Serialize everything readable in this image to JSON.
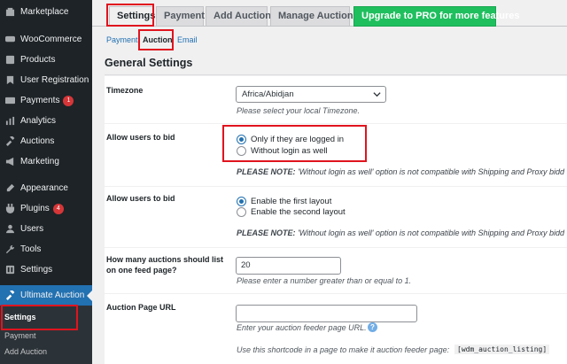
{
  "sidebar": {
    "items": [
      {
        "label": "Marketplace",
        "icon": "marketplace-icon"
      },
      {
        "label": "WooCommerce",
        "icon": "woocommerce-icon"
      },
      {
        "label": "Products",
        "icon": "products-icon"
      },
      {
        "label": "User Registration",
        "icon": "user-registration-icon"
      },
      {
        "label": "Payments",
        "icon": "payments-icon",
        "badge": "1"
      },
      {
        "label": "Analytics",
        "icon": "analytics-icon"
      },
      {
        "label": "Auctions",
        "icon": "auctions-icon"
      },
      {
        "label": "Marketing",
        "icon": "marketing-icon"
      },
      {
        "label": "Appearance",
        "icon": "appearance-icon"
      },
      {
        "label": "Plugins",
        "icon": "plugins-icon",
        "badge": "4"
      },
      {
        "label": "Users",
        "icon": "users-icon"
      },
      {
        "label": "Tools",
        "icon": "tools-icon"
      },
      {
        "label": "Settings",
        "icon": "settings-icon"
      },
      {
        "label": "Ultimate Auction",
        "icon": "ultimate-auction-icon"
      }
    ],
    "submenu": [
      {
        "label": "Settings"
      },
      {
        "label": "Payment"
      },
      {
        "label": "Add Auction"
      }
    ]
  },
  "tabs": [
    {
      "label": "Settings"
    },
    {
      "label": "Payment"
    },
    {
      "label": "Add Auction"
    },
    {
      "label": "Manage Auctions"
    },
    {
      "label": "Upgrade to PRO for more features"
    }
  ],
  "subnav": [
    {
      "label": "Payment"
    },
    {
      "label": "Auction"
    },
    {
      "label": "Email"
    }
  ],
  "general_settings_title": "General Settings",
  "rows": {
    "timezone": {
      "label": "Timezone",
      "selected": "Africa/Abidjan",
      "description": "Please select your local Timezone."
    },
    "allow_bid_1": {
      "label": "Allow users to bid",
      "options": [
        "Only if they are logged in",
        "Without login as well"
      ],
      "note_bold": "PLEASE NOTE:",
      "note_text": " 'Without login as well' option is not compatible with Shipping and Proxy bidd"
    },
    "allow_bid_2": {
      "label": "Allow users to bid",
      "options": [
        "Enable the first layout",
        "Enable the second layout"
      ],
      "note_bold": "PLEASE NOTE:",
      "note_text": " 'Without login as well' option is not compatible with Shipping and Proxy bidd"
    },
    "feed_count": {
      "label_line1": "How many auctions should list",
      "label_line2": "on one feed page?",
      "value": "20",
      "description": "Please enter a number greater than or equal to 1."
    },
    "page_url": {
      "label": "Auction Page URL",
      "value": "",
      "description": "Enter your auction feeder page URL.",
      "help": "?",
      "shortcode_text": "Use this shortcode in a page to make it auction feeder page:",
      "shortcode": "[wdm_auction_listing]"
    }
  },
  "colors": {
    "sidebar_bg": "#1d2327",
    "accent": "#2271b1",
    "highlight_box": "#e0141e",
    "pro_button": "#1fbf5e",
    "badge": "#d63638"
  }
}
